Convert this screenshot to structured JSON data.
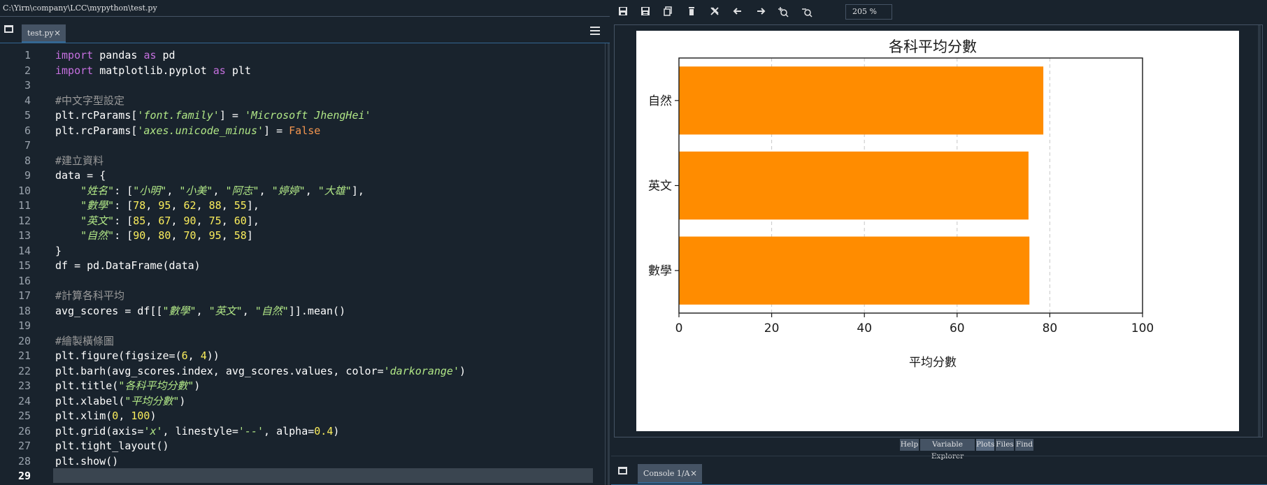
{
  "editor": {
    "file_path": "C:\\Yirn\\company\\LCC\\mypython\\test.py",
    "tab_label": "test.py",
    "current_line": 29,
    "lines": [
      [
        [
          "kw",
          "import"
        ],
        [
          "t",
          " pandas "
        ],
        [
          "kw",
          "as"
        ],
        [
          "t",
          " pd"
        ]
      ],
      [
        [
          "kw",
          "import"
        ],
        [
          "t",
          " matplotlib.pyplot "
        ],
        [
          "kw",
          "as"
        ],
        [
          "t",
          " plt"
        ]
      ],
      [],
      [
        [
          "cmt",
          "#中文字型設定"
        ]
      ],
      [
        [
          "t",
          "plt.rcParams["
        ],
        [
          "str",
          "'font.family'"
        ],
        [
          "t",
          "] = "
        ],
        [
          "str",
          "'Microsoft JhengHei'"
        ]
      ],
      [
        [
          "t",
          "plt.rcParams["
        ],
        [
          "str",
          "'axes.unicode_minus'"
        ],
        [
          "t",
          "] = "
        ],
        [
          "bool",
          "False"
        ]
      ],
      [],
      [
        [
          "cmt",
          "#建立資料"
        ]
      ],
      [
        [
          "t",
          "data = {"
        ]
      ],
      [
        [
          "t",
          "    "
        ],
        [
          "str",
          "\"姓名\""
        ],
        [
          "t",
          ": ["
        ],
        [
          "str",
          "\"小明\""
        ],
        [
          "t",
          ", "
        ],
        [
          "str",
          "\"小美\""
        ],
        [
          "t",
          ", "
        ],
        [
          "str",
          "\"阿志\""
        ],
        [
          "t",
          ", "
        ],
        [
          "str",
          "\"婷婷\""
        ],
        [
          "t",
          ", "
        ],
        [
          "str",
          "\"大雄\""
        ],
        [
          "t",
          "],"
        ]
      ],
      [
        [
          "t",
          "    "
        ],
        [
          "str",
          "\"數學\""
        ],
        [
          "t",
          ": ["
        ],
        [
          "num",
          "78"
        ],
        [
          "t",
          ", "
        ],
        [
          "num",
          "95"
        ],
        [
          "t",
          ", "
        ],
        [
          "num",
          "62"
        ],
        [
          "t",
          ", "
        ],
        [
          "num",
          "88"
        ],
        [
          "t",
          ", "
        ],
        [
          "num",
          "55"
        ],
        [
          "t",
          "],"
        ]
      ],
      [
        [
          "t",
          "    "
        ],
        [
          "str",
          "\"英文\""
        ],
        [
          "t",
          ": ["
        ],
        [
          "num",
          "85"
        ],
        [
          "t",
          ", "
        ],
        [
          "num",
          "67"
        ],
        [
          "t",
          ", "
        ],
        [
          "num",
          "90"
        ],
        [
          "t",
          ", "
        ],
        [
          "num",
          "75"
        ],
        [
          "t",
          ", "
        ],
        [
          "num",
          "60"
        ],
        [
          "t",
          "],"
        ]
      ],
      [
        [
          "t",
          "    "
        ],
        [
          "str",
          "\"自然\""
        ],
        [
          "t",
          ": ["
        ],
        [
          "num",
          "90"
        ],
        [
          "t",
          ", "
        ],
        [
          "num",
          "80"
        ],
        [
          "t",
          ", "
        ],
        [
          "num",
          "70"
        ],
        [
          "t",
          ", "
        ],
        [
          "num",
          "95"
        ],
        [
          "t",
          ", "
        ],
        [
          "num",
          "58"
        ],
        [
          "t",
          "]"
        ]
      ],
      [
        [
          "t",
          "}"
        ]
      ],
      [
        [
          "t",
          "df = pd.DataFrame(data)"
        ]
      ],
      [],
      [
        [
          "cmt",
          "#計算各科平均"
        ]
      ],
      [
        [
          "t",
          "avg_scores = df[["
        ],
        [
          "str",
          "\"數學\""
        ],
        [
          "t",
          ", "
        ],
        [
          "str",
          "\"英文\""
        ],
        [
          "t",
          ", "
        ],
        [
          "str",
          "\"自然\""
        ],
        [
          "t",
          "]].mean()"
        ]
      ],
      [],
      [
        [
          "cmt",
          "#繪製橫條圖"
        ]
      ],
      [
        [
          "t",
          "plt.figure(figsize=("
        ],
        [
          "num",
          "6"
        ],
        [
          "t",
          ", "
        ],
        [
          "num",
          "4"
        ],
        [
          "t",
          "))"
        ]
      ],
      [
        [
          "t",
          "plt.barh(avg_scores.index, avg_scores.values, color="
        ],
        [
          "str",
          "'darkorange'"
        ],
        [
          "t",
          ")"
        ]
      ],
      [
        [
          "t",
          "plt.title("
        ],
        [
          "str",
          "\"各科平均分數\""
        ],
        [
          "t",
          ")"
        ]
      ],
      [
        [
          "t",
          "plt.xlabel("
        ],
        [
          "str",
          "\"平均分數\""
        ],
        [
          "t",
          ")"
        ]
      ],
      [
        [
          "t",
          "plt.xlim("
        ],
        [
          "num",
          "0"
        ],
        [
          "t",
          ", "
        ],
        [
          "num",
          "100"
        ],
        [
          "t",
          ")"
        ]
      ],
      [
        [
          "t",
          "plt.grid(axis="
        ],
        [
          "str",
          "'x'"
        ],
        [
          "t",
          ", linestyle="
        ],
        [
          "str",
          "'--'"
        ],
        [
          "t",
          ", alpha="
        ],
        [
          "num",
          "0.4"
        ],
        [
          "t",
          ")"
        ]
      ],
      [
        [
          "t",
          "plt.tight_layout()"
        ]
      ],
      [
        [
          "t",
          "plt.show()"
        ]
      ],
      []
    ]
  },
  "plots": {
    "zoom": "205 %",
    "toolbar_icons": [
      "save-icon",
      "save-all-icon",
      "copy-icon",
      "delete-icon",
      "delete-all-icon",
      "previous-icon",
      "next-icon",
      "zoom-in-icon",
      "zoom-out-icon"
    ],
    "pane_tabs": [
      "Help",
      "Variable Explorer",
      "Plots",
      "Files",
      "Find"
    ],
    "active_tab": "Plots"
  },
  "console": {
    "tab_label": "Console 1/A"
  },
  "chart_data": {
    "type": "bar",
    "orientation": "horizontal",
    "title": "各科平均分數",
    "xlabel": "平均分數",
    "ylabel": "",
    "categories": [
      "數學",
      "英文",
      "自然"
    ],
    "values": [
      75.6,
      75.4,
      78.6
    ],
    "xlim": [
      0,
      100
    ],
    "xticks": [
      0,
      20,
      40,
      60,
      80,
      100
    ],
    "bar_color": "#ff8c00",
    "grid": "x, dashed",
    "legend": "none"
  }
}
